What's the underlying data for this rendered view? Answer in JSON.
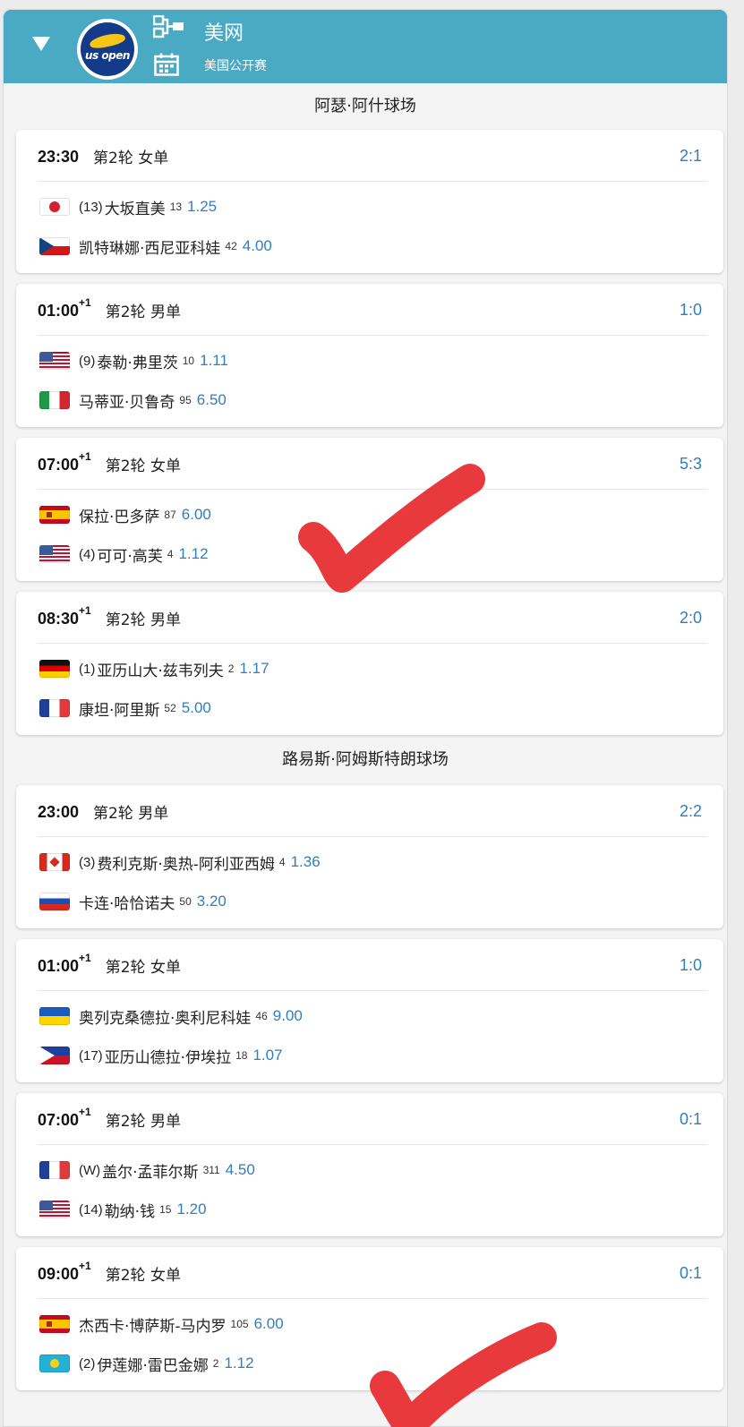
{
  "header": {
    "title": "美网",
    "subtitle": "美国公开赛",
    "logo_text": "us open",
    "icons": [
      "collapse-caret",
      "bracket-icon",
      "calendar-icon"
    ]
  },
  "courts": [
    {
      "name": "阿瑟·阿什球场",
      "matches": [
        {
          "time": "23:30",
          "day_offset": "",
          "round": "第2轮 女单",
          "score": "2:1",
          "p1": {
            "flag": "jp",
            "seed": "(13)",
            "name": "大坂直美",
            "rank": "13",
            "odds": "1.25"
          },
          "p2": {
            "flag": "cz",
            "seed": "",
            "name": "凯特琳娜·西尼亚科娃",
            "rank": "42",
            "odds": "4.00"
          }
        },
        {
          "time": "01:00",
          "day_offset": "+1",
          "round": "第2轮 男单",
          "score": "1:0",
          "p1": {
            "flag": "us",
            "seed": "(9)",
            "name": "泰勒·弗里茨",
            "rank": "10",
            "odds": "1.11"
          },
          "p2": {
            "flag": "it",
            "seed": "",
            "name": "马蒂亚·贝鲁奇",
            "rank": "95",
            "odds": "6.50"
          }
        },
        {
          "time": "07:00",
          "day_offset": "+1",
          "round": "第2轮 女单",
          "score": "5:3",
          "p1": {
            "flag": "es",
            "seed": "",
            "name": "保拉·巴多萨",
            "rank": "87",
            "odds": "6.00"
          },
          "p2": {
            "flag": "us",
            "seed": "(4)",
            "name": "可可·高芙",
            "rank": "4",
            "odds": "1.12"
          }
        },
        {
          "time": "08:30",
          "day_offset": "+1",
          "round": "第2轮 男单",
          "score": "2:0",
          "p1": {
            "flag": "de",
            "seed": "(1)",
            "name": "亚历山大·兹韦列夫",
            "rank": "2",
            "odds": "1.17"
          },
          "p2": {
            "flag": "fr",
            "seed": "",
            "name": "康坦·阿里斯",
            "rank": "52",
            "odds": "5.00"
          }
        }
      ]
    },
    {
      "name": "路易斯·阿姆斯特朗球场",
      "matches": [
        {
          "time": "23:00",
          "day_offset": "",
          "round": "第2轮 男单",
          "score": "2:2",
          "p1": {
            "flag": "ca",
            "seed": "(3)",
            "name": "费利克斯·奥热-阿利亚西姆",
            "rank": "4",
            "odds": "1.36"
          },
          "p2": {
            "flag": "ru",
            "seed": "",
            "name": "卡连·哈恰诺夫",
            "rank": "50",
            "odds": "3.20"
          }
        },
        {
          "time": "01:00",
          "day_offset": "+1",
          "round": "第2轮 女单",
          "score": "1:0",
          "p1": {
            "flag": "ua",
            "seed": "",
            "name": "奥列克桑德拉·奥利尼科娃",
            "rank": "46",
            "odds": "9.00"
          },
          "p2": {
            "flag": "ph",
            "seed": "(17)",
            "name": "亚历山德拉·伊埃拉",
            "rank": "18",
            "odds": "1.07"
          }
        },
        {
          "time": "07:00",
          "day_offset": "+1",
          "round": "第2轮 男单",
          "score": "0:1",
          "p1": {
            "flag": "fr",
            "seed": "(W)",
            "name": "盖尔·孟菲尔斯",
            "rank": "311",
            "odds": "4.50"
          },
          "p2": {
            "flag": "us",
            "seed": "(14)",
            "name": "勒纳·钱",
            "rank": "15",
            "odds": "1.20"
          }
        },
        {
          "time": "09:00",
          "day_offset": "+1",
          "round": "第2轮 女单",
          "score": "0:1",
          "p1": {
            "flag": "es",
            "seed": "",
            "name": "杰西卡·博萨斯-马内罗",
            "rank": "105",
            "odds": "6.00"
          },
          "p2": {
            "flag": "kz",
            "seed": "(2)",
            "name": "伊莲娜·雷巴金娜",
            "rank": "2",
            "odds": "1.12"
          }
        }
      ]
    }
  ],
  "annotations": {
    "checkmark_color": "#e8393c",
    "marks": [
      "check-mark-match-3",
      "check-mark-match-8"
    ]
  },
  "colors": {
    "header_bg": "#4aa9c3",
    "accent_blue": "#2f7fbf"
  }
}
